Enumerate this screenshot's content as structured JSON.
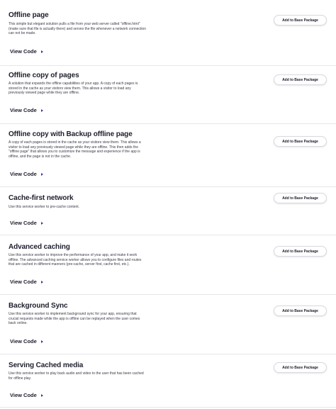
{
  "items": [
    {
      "title": "Offline page",
      "description": "This simple but elegant solution pulls a file from your web server called \"offline.html\" (make sure that file is actually there) and serves the file whenever a network connection can not be made.",
      "view_code_label": "View Code",
      "add_label": "Add to Base Package"
    },
    {
      "title": "Offline copy of pages",
      "description": "A solution that expands the offline capabilities of your app. A copy of each pages is stored in the cache as your visitors view them. This allows a visitor to load any previously viewed page while they are offline.",
      "view_code_label": "View Code",
      "add_label": "Add to Base Package"
    },
    {
      "title": "Offline copy with Backup offline page",
      "description": "A copy of each pages is stored in the cache as your visitors view them. This allows a visitor to load any previously viewed page while they are offline. This then adds the \"offline page\" that allows you to customize the message and experience if the app is offline, and the page is not in the cache.",
      "view_code_label": "View Code",
      "add_label": "Add to Base Package"
    },
    {
      "title": "Cache-first network",
      "description": "Use this service worker to pre-cache content.",
      "view_code_label": "View Code",
      "add_label": "Add to Base Package"
    },
    {
      "title": "Advanced caching",
      "description": "Use this service worker to improve the performance of your app, and make it work offline. The advanced caching service worker allows you to configure files and routes that are cached in different manners (pre-cache, server first, cache first, etc.).",
      "view_code_label": "View Code",
      "add_label": "Add to Base Package"
    },
    {
      "title": "Background Sync",
      "description": "Use this service worker to implement background sync for your app, ensuring that crucial requests made while the app is offline can be replayed when the user comes back online.",
      "view_code_label": "View Code",
      "add_label": "Add to Base Package"
    },
    {
      "title": "Serving Cached media",
      "description": "Use this service worker to play back audio and video to the user that has been cached for offline play.",
      "view_code_label": "View Code",
      "add_label": "Add to Base Package"
    }
  ]
}
